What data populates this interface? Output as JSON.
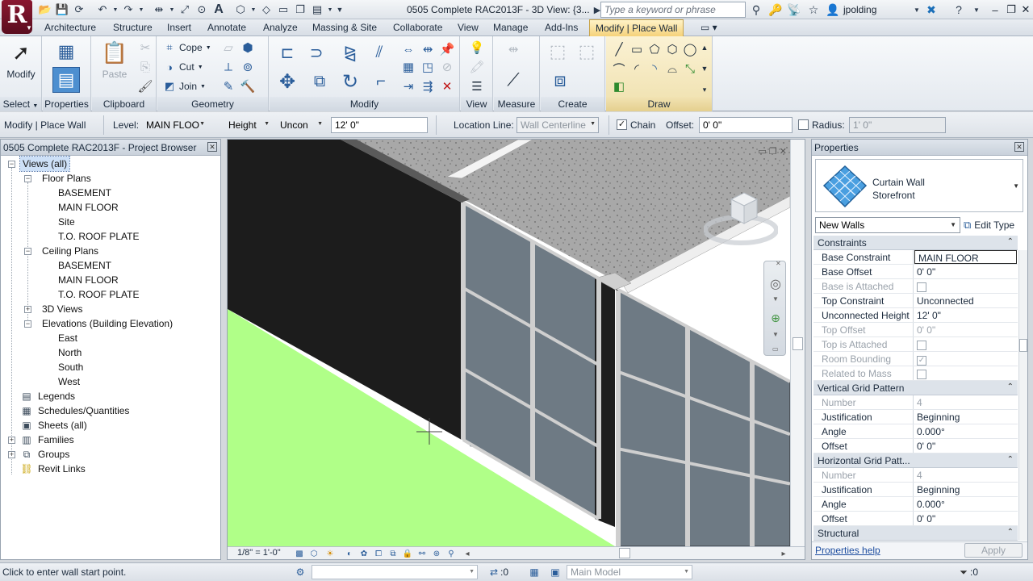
{
  "titlebar": {
    "window_title": "0505 Complete RAC2013F - 3D View: {3...",
    "search_placeholder": "Type a keyword or phrase",
    "user": "jpolding",
    "app_letter": "R"
  },
  "ribbon_tabs": [
    "Architecture",
    "Structure",
    "Insert",
    "Annotate",
    "Analyze",
    "Massing & Site",
    "Collaborate",
    "View",
    "Manage",
    "Add-Ins",
    "Modify | Place Wall"
  ],
  "ribbon": {
    "select": {
      "modify_label": "Modify",
      "title": "Select"
    },
    "properties": {
      "title": "Properties"
    },
    "clipboard": {
      "paste_label": "Paste",
      "title": "Clipboard"
    },
    "geometry": {
      "cope_label": "Cope",
      "cut_label": "Cut",
      "join_label": "Join",
      "title": "Geometry"
    },
    "modify": {
      "title": "Modify"
    },
    "view": {
      "title": "View"
    },
    "measure": {
      "title": "Measure"
    },
    "create": {
      "title": "Create"
    },
    "draw": {
      "title": "Draw"
    }
  },
  "optionsbar": {
    "context": "Modify | Place Wall",
    "level_label": "Level:",
    "level_value": "MAIN FLOO",
    "height_value": "Height",
    "constraint_value": "Uncon",
    "height_input": "12'  0\"",
    "location_line_label": "Location Line:",
    "location_line_value": "Wall Centerline",
    "chain_label": "Chain",
    "chain_checked": "✓",
    "offset_label": "Offset:",
    "offset_value": "0'  0\"",
    "radius_label": "Radius:",
    "radius_value": "1'  0\""
  },
  "browser": {
    "title": "0505 Complete RAC2013F - Project Browser",
    "views_all": "Views (all)",
    "floor_plans": "Floor Plans",
    "floor_plan_items": [
      "BASEMENT",
      "MAIN FLOOR",
      "Site",
      "T.O. ROOF PLATE"
    ],
    "ceiling_plans": "Ceiling Plans",
    "ceiling_plan_items": [
      "BASEMENT",
      "MAIN FLOOR",
      "T.O. ROOF PLATE"
    ],
    "views_3d": "3D Views",
    "elevations": "Elevations (Building Elevation)",
    "elevation_items": [
      "East",
      "North",
      "South",
      "West"
    ],
    "legends": "Legends",
    "schedules": "Schedules/Quantities",
    "sheets": "Sheets (all)",
    "families": "Families",
    "groups": "Groups",
    "revit_links": "Revit Links"
  },
  "viewport": {
    "scale": "1/8\" = 1'-0\"",
    "colors": {
      "ground": "#b0ff88",
      "wall": "#1c1c1c",
      "roof": "#a8a8a8",
      "glass": "#6e7a84",
      "mullion": "#cfcfcf"
    }
  },
  "properties": {
    "title": "Properties",
    "type_line1": "Curtain Wall",
    "type_line2": "Storefront",
    "instance_filter": "New Walls",
    "edit_type": "Edit Type",
    "groups": {
      "constraints": "Constraints",
      "vertical": "Vertical Grid Pattern",
      "horizontal": "Horizontal Grid Patt...",
      "structural": "Structural"
    },
    "rows": {
      "base_constraint": {
        "name": "Base Constraint",
        "value": "MAIN FLOOR"
      },
      "base_offset": {
        "name": "Base Offset",
        "value": "0'  0\""
      },
      "base_attached": {
        "name": "Base is Attached"
      },
      "top_constraint": {
        "name": "Top Constraint",
        "value": "Unconnected"
      },
      "unconnected_height": {
        "name": "Unconnected Height",
        "value": "12'  0\""
      },
      "top_offset": {
        "name": "Top Offset",
        "value": "0'  0\""
      },
      "top_attached": {
        "name": "Top is Attached"
      },
      "room_bounding": {
        "name": "Room Bounding",
        "check": "✓"
      },
      "related_mass": {
        "name": "Related to Mass"
      },
      "v_number": {
        "name": "Number",
        "value": "4"
      },
      "v_justification": {
        "name": "Justification",
        "value": "Beginning"
      },
      "v_angle": {
        "name": "Angle",
        "value": "0.000°"
      },
      "v_offset": {
        "name": "Offset",
        "value": "0'  0\""
      },
      "h_number": {
        "name": "Number",
        "value": "4"
      },
      "h_justification": {
        "name": "Justification",
        "value": "Beginning"
      },
      "h_angle": {
        "name": "Angle",
        "value": "0.000°"
      },
      "h_offset": {
        "name": "Offset",
        "value": "0'  0\""
      }
    },
    "help": "Properties help",
    "apply": "Apply"
  },
  "statusbar": {
    "text": "Click to enter wall start point.",
    "count": ":0",
    "model": "Main Model",
    "filter_count": ":0"
  }
}
